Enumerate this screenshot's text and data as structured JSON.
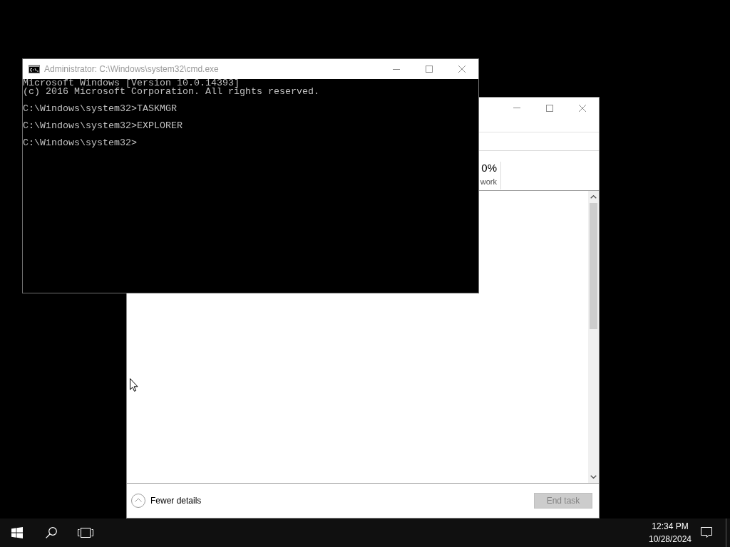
{
  "console_window": {
    "title": "Administrator: C:\\Windows\\system32\\cmd.exe",
    "active": false,
    "output_blocks": [
      [
        "Microsoft Windows [Version 10.0.14393]",
        "(c) 2016 Microsoft Corporation. All rights reserved."
      ],
      [
        "C:\\Windows\\system32>TASKMGR"
      ],
      [
        "C:\\Windows\\system32>EXPLORER"
      ],
      [
        "C:\\Windows\\system32>"
      ]
    ]
  },
  "task_manager": {
    "columns": [
      {
        "value": "0%",
        "label": "work"
      }
    ],
    "details_toggle": {
      "label": "Fewer details"
    },
    "end_task_button": {
      "label": "End task",
      "disabled": true
    }
  },
  "taskbar": {
    "clock": {
      "time": "12:34 PM",
      "date": "10/28/2024"
    }
  }
}
